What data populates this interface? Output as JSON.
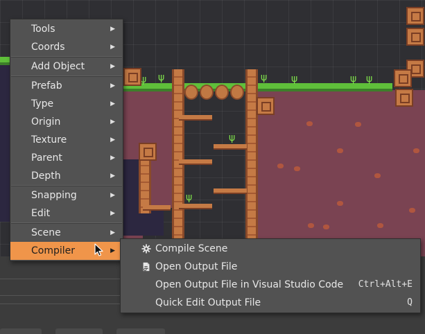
{
  "context_menu": {
    "items": [
      {
        "label": "Tools",
        "arrow": "▶"
      },
      {
        "label": "Coords",
        "arrow": "▶"
      },
      {
        "label": "Add Object",
        "arrow": "▶"
      },
      {
        "label": "Prefab",
        "arrow": "▶"
      },
      {
        "label": "Type",
        "arrow": "▶"
      },
      {
        "label": "Origin",
        "arrow": "▶"
      },
      {
        "label": "Texture",
        "arrow": "▶"
      },
      {
        "label": "Parent",
        "arrow": "▶"
      },
      {
        "label": "Depth",
        "arrow": "▶"
      },
      {
        "label": "Snapping",
        "arrow": "▶"
      },
      {
        "label": "Edit",
        "arrow": "▶"
      },
      {
        "label": "Scene",
        "arrow": "▶"
      },
      {
        "label": "Compiler",
        "arrow": "▶"
      }
    ],
    "active_item": "Compiler",
    "highlight_color": "#f0954a"
  },
  "compiler_submenu": {
    "items": [
      {
        "label": "Compile Scene",
        "icon": "gear-icon",
        "shortcut": ""
      },
      {
        "label": "Open Output File",
        "icon": "file-icon",
        "shortcut": ""
      },
      {
        "label": "Open Output File in Visual Studio Code",
        "icon": "",
        "shortcut": "Ctrl+Alt+E"
      },
      {
        "label": "Quick Edit Output File",
        "icon": "",
        "shortcut": "Q"
      }
    ]
  }
}
